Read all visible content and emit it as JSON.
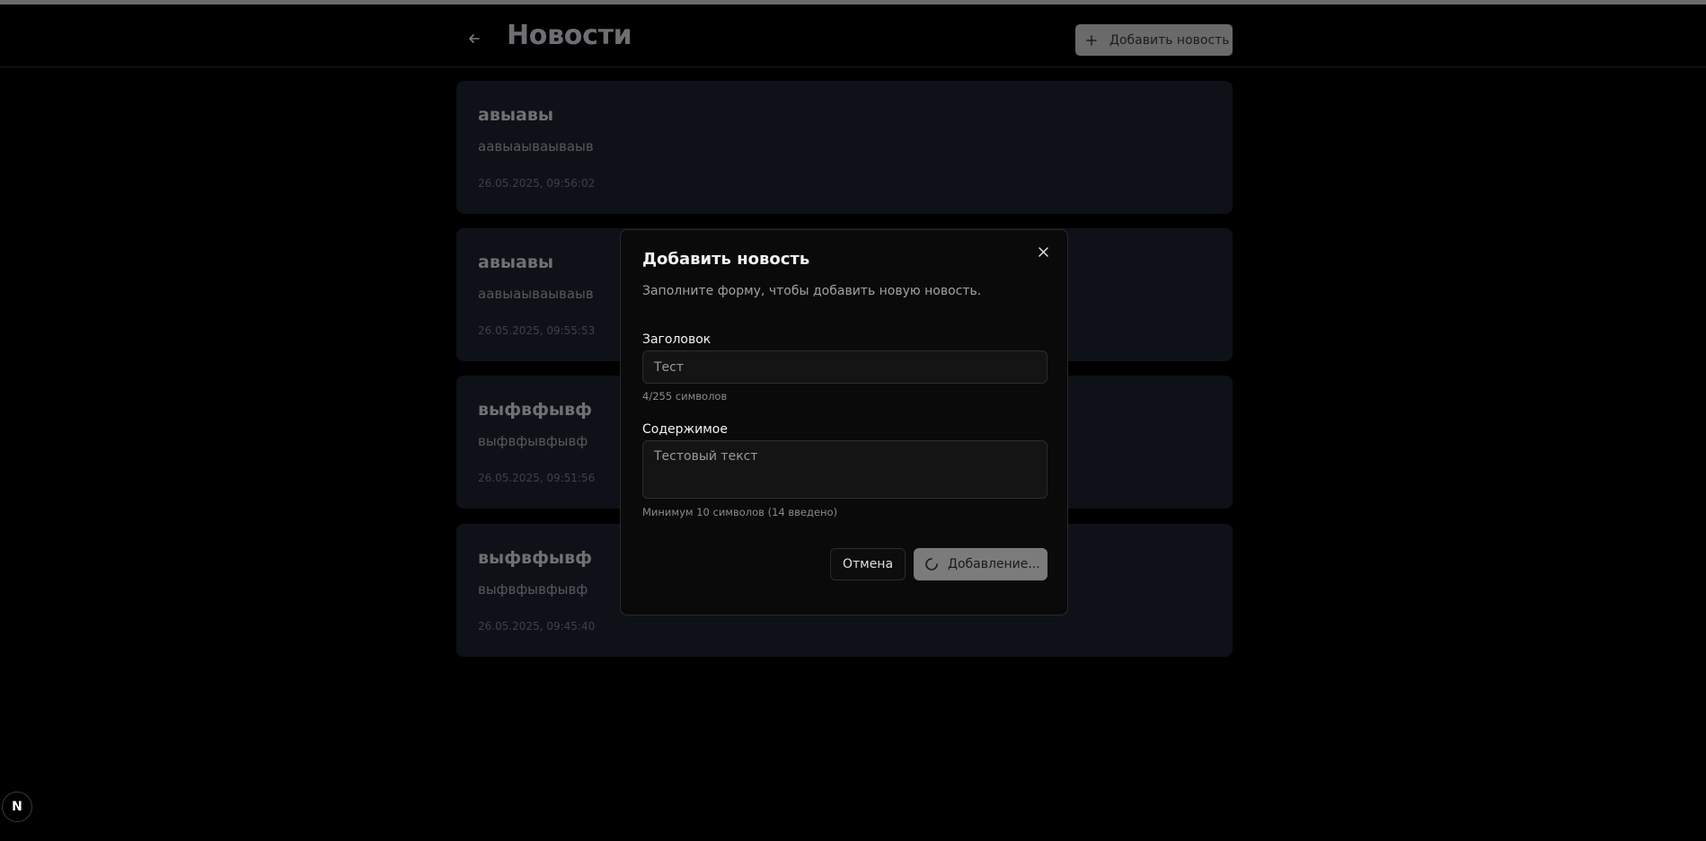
{
  "header": {
    "title": "Новости",
    "add_button_label": "Добавить новость",
    "back_icon": "arrow-left-icon",
    "plus_icon": "plus-icon"
  },
  "news": [
    {
      "title": "авыавы",
      "body": "аавыаываываыв",
      "date": "26.05.2025, 09:56:02"
    },
    {
      "title": "авыавы",
      "body": "аавыаываываыв",
      "date": "26.05.2025, 09:55:53"
    },
    {
      "title": "выфвфывф",
      "body": "выфвфывфывф",
      "date": "26.05.2025, 09:51:56"
    },
    {
      "title": "выфвфывф",
      "body": "выфвфывфывф",
      "date": "26.05.2025, 09:45:40"
    }
  ],
  "modal": {
    "title": "Добавить новость",
    "description": "Заполните форму, чтобы добавить новую новость.",
    "title_label": "Заголовок",
    "title_value": "Тест",
    "title_hint": "4/255 символов",
    "content_label": "Содержимое",
    "content_value": "Тестовый текст",
    "content_hint": "Минимум 10 символов (14 введено)",
    "cancel_label": "Отмена",
    "submit_label": "Добавление...",
    "close_icon": "close-icon",
    "spinner_icon": "spinner-icon"
  },
  "badge": {
    "label": "N"
  },
  "colors": {
    "background": "#000000",
    "card": "#0e1117",
    "modal": "#0a0a0a",
    "button": "#7b7b7b"
  }
}
